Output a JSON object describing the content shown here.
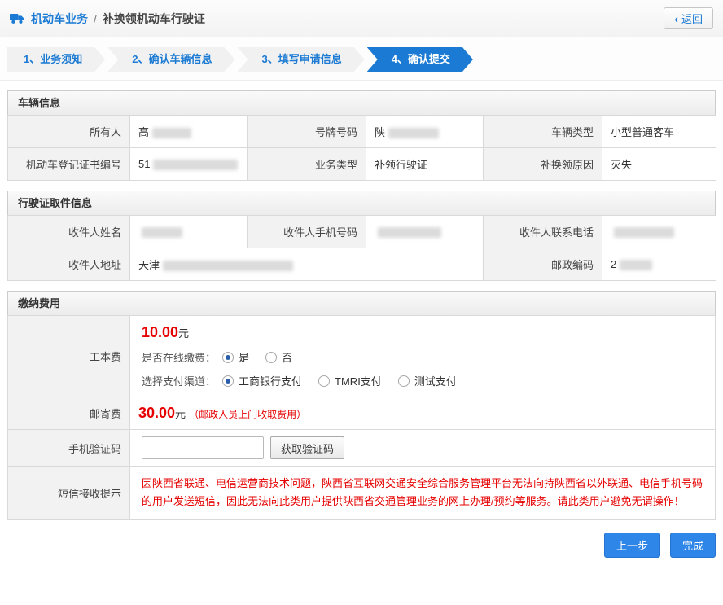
{
  "colors": {
    "accent_blue": "#1b7ad3",
    "price_red": "#e60000"
  },
  "header": {
    "title_primary": "机动车业务",
    "separator": "/",
    "title_secondary": "补换领机动车行驶证",
    "back_chevron": "‹",
    "back_label": "返回"
  },
  "steps": {
    "active_index": 3,
    "items": [
      {
        "label": "1、业务须知"
      },
      {
        "label": "2、确认车辆信息"
      },
      {
        "label": "3、填写申请信息"
      },
      {
        "label": "4、确认提交"
      }
    ]
  },
  "vehicle_info": {
    "title": "车辆信息",
    "fields": {
      "owner": {
        "label": "所有人",
        "value": "高",
        "redacted": true
      },
      "plate": {
        "label": "号牌号码",
        "value": "陕",
        "redacted": true
      },
      "vehicle_type": {
        "label": "车辆类型",
        "value": "小型普通客车",
        "redacted": false
      },
      "registration_no": {
        "label": "机动车登记证书编号",
        "value": "51",
        "redacted": true
      },
      "business_type": {
        "label": "业务类型",
        "value": "补领行驶证",
        "redacted": false
      },
      "reason": {
        "label": "补换领原因",
        "value": "灭失",
        "redacted": false
      }
    }
  },
  "pickup_info": {
    "title": "行驶证取件信息",
    "fields": {
      "recipient_name": {
        "label": "收件人姓名",
        "value": "",
        "redacted": true
      },
      "recipient_mobile": {
        "label": "收件人手机号码",
        "value": "",
        "redacted": true
      },
      "recipient_phone": {
        "label": "收件人联系电话",
        "value": "",
        "redacted": true
      },
      "recipient_address": {
        "label": "收件人地址",
        "value": "天津",
        "redacted": true
      },
      "postal_code": {
        "label": "邮政编码",
        "value": "2",
        "redacted": true
      }
    }
  },
  "fees": {
    "title": "缴纳费用",
    "cost_fee": {
      "label": "工本费",
      "amount": "10.00",
      "unit": "元",
      "online_question": "是否在线缴费：",
      "online_options": [
        {
          "label": "是",
          "selected": true
        },
        {
          "label": "否",
          "selected": false
        }
      ],
      "channel_question": "选择支付渠道：",
      "channel_options": [
        {
          "label": "工商银行支付",
          "selected": true
        },
        {
          "label": "TMRI支付",
          "selected": false
        },
        {
          "label": "测试支付",
          "selected": false
        }
      ]
    },
    "postage_fee": {
      "label": "邮寄费",
      "amount": "30.00",
      "unit": "元",
      "note": "（邮政人员上门收取费用）"
    },
    "sms_code": {
      "label": "手机验证码",
      "input_value": "",
      "button_label": "获取验证码"
    },
    "sms_notice": {
      "label": "短信接收提示",
      "text": "因陕西省联通、电信运营商技术问题，陕西省互联网交通安全综合服务管理平台无法向持陕西省以外联通、电信手机号码的用户发送短信，因此无法向此类用户提供陕西省交通管理业务的网上办理/预约等服务。请此类用户避免无谓操作！"
    }
  },
  "footer": {
    "prev_label": "上一步",
    "finish_label": "完成"
  }
}
